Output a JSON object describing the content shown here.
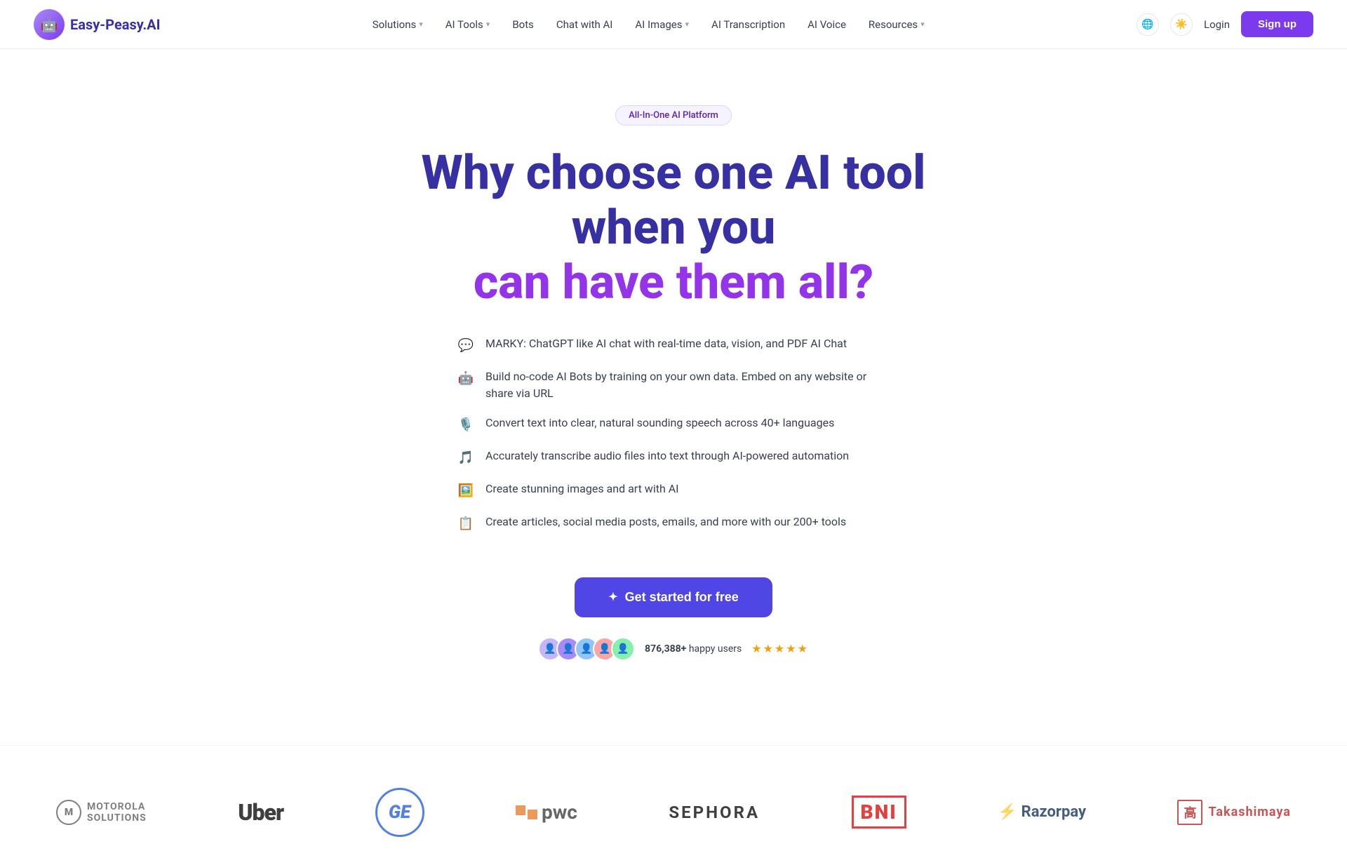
{
  "nav": {
    "logo_text": "Easy-Peasy.AI",
    "logo_emoji": "🤖",
    "links": [
      {
        "label": "Solutions",
        "has_dropdown": true
      },
      {
        "label": "AI Tools",
        "has_dropdown": true
      },
      {
        "label": "Bots",
        "has_dropdown": false
      },
      {
        "label": "Chat with AI",
        "has_dropdown": false
      },
      {
        "label": "AI Images",
        "has_dropdown": true
      },
      {
        "label": "AI Transcription",
        "has_dropdown": false
      },
      {
        "label": "AI Voice",
        "has_dropdown": false
      },
      {
        "label": "Resources",
        "has_dropdown": true
      }
    ],
    "login_label": "Login",
    "signup_label": "Sign up"
  },
  "hero": {
    "badge": "All-In-One AI Platform",
    "title_line1": "Why choose one AI tool when you",
    "title_line2": "can have them all?",
    "features": [
      {
        "icon": "💬",
        "text": "MARKY: ChatGPT like AI chat with real-time data, vision, and PDF AI Chat"
      },
      {
        "icon": "🤖",
        "text": "Build no-code AI Bots by training on your own data. Embed on any website or share via URL"
      },
      {
        "icon": "🎙️",
        "text": "Convert text into clear, natural sounding speech across 40+ languages"
      },
      {
        "icon": "🎵",
        "text": "Accurately transcribe audio files into text through AI-powered automation"
      },
      {
        "icon": "🖼️",
        "text": "Create stunning images and art with AI"
      },
      {
        "icon": "📋",
        "text": "Create articles, social media posts, emails, and more with our 200+ tools"
      }
    ],
    "cta_label": "Get started for free",
    "cta_icon": "✦",
    "social_proof": {
      "count": "876,388+",
      "label": "happy users",
      "stars": "★★★★★"
    }
  },
  "logos": [
    {
      "name": "Motorola Solutions",
      "type": "motorola"
    },
    {
      "name": "Uber",
      "type": "uber"
    },
    {
      "name": "GE",
      "type": "ge"
    },
    {
      "name": "PwC",
      "type": "pwc"
    },
    {
      "name": "SEPHORA",
      "type": "sephora"
    },
    {
      "name": "BNI",
      "type": "bni"
    },
    {
      "name": "Razorpay",
      "type": "razorpay"
    },
    {
      "name": "Takashimaya",
      "type": "takashimaya"
    }
  ],
  "colors": {
    "brand_purple": "#7c3aed",
    "brand_blue": "#3730a3",
    "accent": "#4f46e5"
  }
}
